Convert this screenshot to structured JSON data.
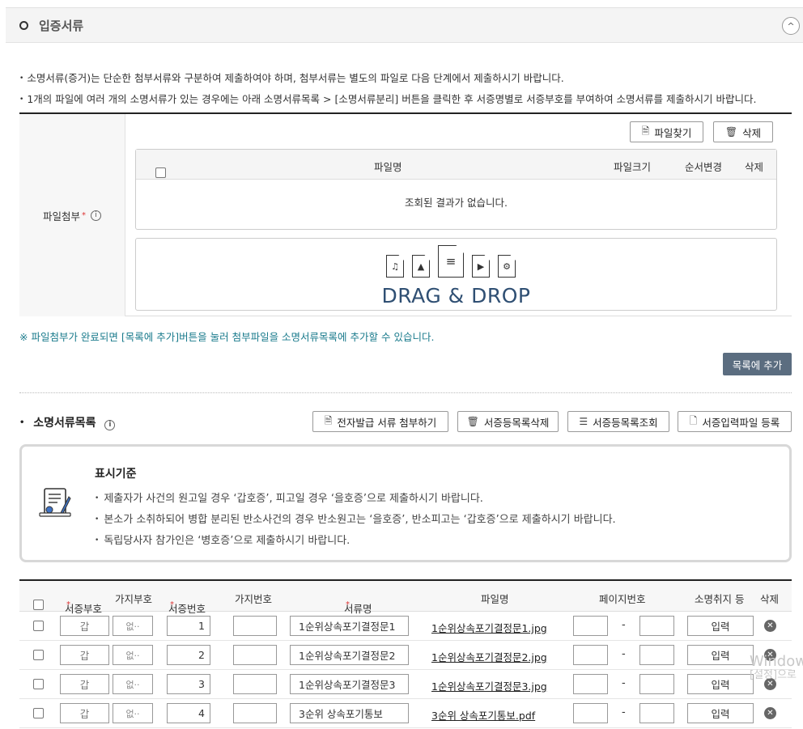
{
  "section": {
    "title": "입증서류",
    "collapse_icon": "^"
  },
  "notices": [
    "소명서류(증거)는 단순한 첨부서류와 구분하여 제출하여야 하며, 첨부서류는 별도의 파일로 다음 단계에서 제출하시기 바랍니다.",
    "1개의 파일에 여러 개의 소명서류가 있는 경우에는 아래 소명서류목록 > [소명서류분리] 버튼을 클릭한 후 서증명별로 서증부호를 부여하여 소명서류를 제출하시기 바랍니다."
  ],
  "attach": {
    "label": "파일첨부",
    "required_mark": "*",
    "find_button": "파일찾기",
    "delete_button": "삭제",
    "table_headers": {
      "filename": "파일명",
      "filesize": "파일크기",
      "order": "순서변경",
      "delete": "삭제"
    },
    "empty_message": "조회된 결과가 없습니다.",
    "drop_text": "DRAG & DROP"
  },
  "add_note": "※ 파일첨부가 완료되면 [목록에 추가]버튼을 눌러 첨부파일을 소명서류목록에 추가할 수 있습니다.",
  "add_to_list_button": "목록에 추가",
  "doc_list": {
    "title": "소명서류목록",
    "buttons": {
      "electronic": "전자발급 서류 첨부하기",
      "delete_list": "서증등목록삭제",
      "view_list": "서증등목록조회",
      "register_file": "서증입력파일 등록"
    }
  },
  "criteria": {
    "title": "표시기준",
    "items": [
      "제출자가 사건의 원고일 경우 ‘갑호증’, 피고일 경우 ‘을호증’으로 제출하시기 바랍니다.",
      "본소가 소취하되어 병합 분리된 반소사건의 경우 반소원고는 ‘을호증’, 반소피고는 ‘갑호증’으로 제출하시기 바랍니다.",
      "독립당사자 참가인은 ‘병호증’으로 제출하시기 바랍니다."
    ]
  },
  "doc_table": {
    "headers": {
      "code": "서증부호",
      "branch_code": "가지부호",
      "number": "서증번호",
      "branch_number": "가지번호",
      "doc_name": "서류명",
      "file_name": "파일명",
      "page": "페이지번호",
      "withdraw": "소명취지 등",
      "delete": "삭제"
    },
    "rows": [
      {
        "code": "갑",
        "branch": "없··",
        "number": "1",
        "doc_name": "1순위상속포기결정문1",
        "file_name": "1순위상속포기결정문1.jpg",
        "input": "입력"
      },
      {
        "code": "갑",
        "branch": "없··",
        "number": "2",
        "doc_name": "1순위상속포기결정문2",
        "file_name": "1순위상속포기결정문2.jpg",
        "input": "입력"
      },
      {
        "code": "갑",
        "branch": "없··",
        "number": "3",
        "doc_name": "1순위상속포기결정문3",
        "file_name": "1순위상속포기결정문3.jpg",
        "input": "입력"
      },
      {
        "code": "갑",
        "branch": "없··",
        "number": "4",
        "doc_name": "3순위 상속포기통보",
        "file_name": "3순위 상속포기통보.pdf",
        "input": "입력"
      }
    ],
    "dash": "-"
  },
  "watermark": {
    "line1": "Window",
    "line2": "[설정]으로"
  }
}
